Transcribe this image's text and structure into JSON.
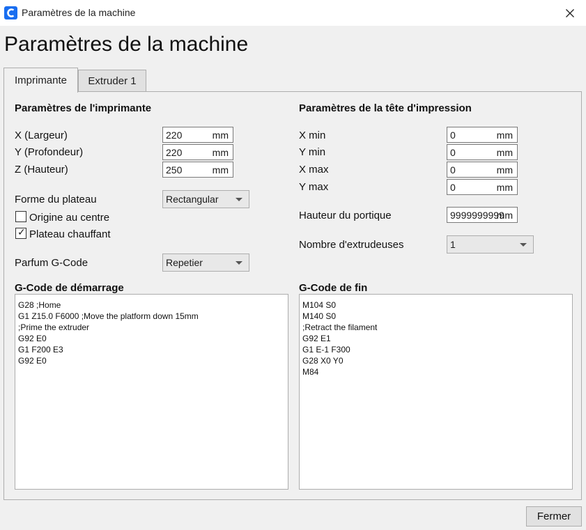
{
  "window": {
    "title": "Paramètres de la machine"
  },
  "page": {
    "title": "Paramètres de la machine"
  },
  "tabs": [
    {
      "label": "Imprimante",
      "active": true
    },
    {
      "label": "Extruder 1",
      "active": false
    }
  ],
  "printer": {
    "section_title": "Paramètres de l'imprimante",
    "x_label": "X (Largeur)",
    "x_value": "220",
    "y_label": "Y (Profondeur)",
    "y_value": "220",
    "z_label": "Z (Hauteur)",
    "z_value": "250",
    "unit": "mm",
    "bed_shape_label": "Forme du plateau",
    "bed_shape_value": "Rectangular",
    "origin_center_label": "Origine au centre",
    "origin_center_checked": false,
    "heated_bed_label": "Plateau chauffant",
    "heated_bed_checked": true,
    "gcode_flavor_label": "Parfum G-Code",
    "gcode_flavor_value": "Repetier"
  },
  "printhead": {
    "section_title": "Paramètres de la tête d'impression",
    "xmin_label": "X min",
    "xmin_value": "0",
    "ymin_label": "Y min",
    "ymin_value": "0",
    "xmax_label": "X max",
    "xmax_value": "0",
    "ymax_label": "Y max",
    "ymax_value": "0",
    "unit": "mm",
    "gantry_label": "Hauteur du portique",
    "gantry_value": "9999999999",
    "extruders_label": "Nombre d'extrudeuses",
    "extruders_value": "1"
  },
  "start_gcode": {
    "title": "G-Code de démarrage",
    "lines": [
      "G28 ;Home",
      "G1 Z15.0 F6000 ;Move the platform down 15mm",
      ";Prime the extruder",
      "G92 E0",
      "G1 F200 E3",
      "G92 E0"
    ]
  },
  "end_gcode": {
    "title": "G-Code de fin",
    "lines": [
      "M104 S0",
      "M140 S0",
      ";Retract the filament",
      "G92 E1",
      "G1 E-1 F300",
      "G28 X0 Y0",
      "M84"
    ]
  },
  "footer": {
    "close_label": "Fermer"
  },
  "colors": {
    "accent": "#196ef0"
  },
  "icons": {
    "app": "cura-logo-icon",
    "close": "close-icon",
    "dropdown": "chevron-down-icon",
    "check": "check-icon"
  }
}
